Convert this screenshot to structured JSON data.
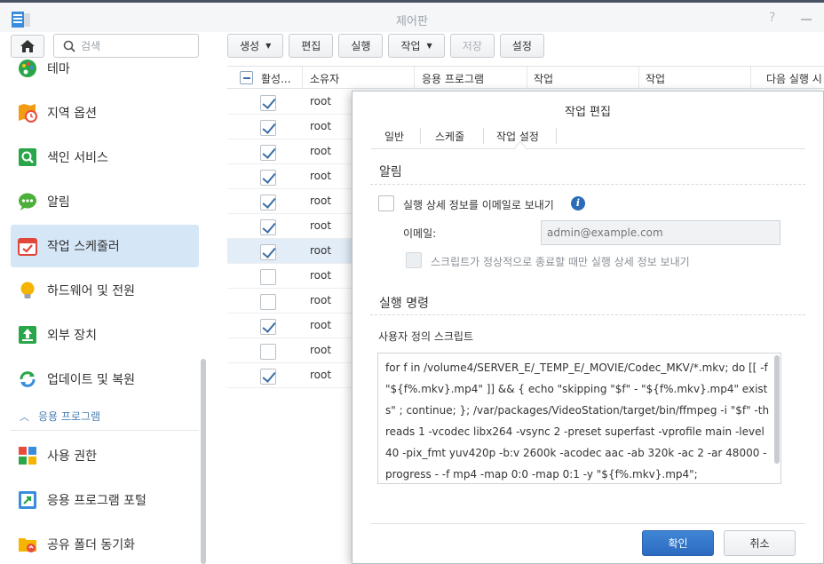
{
  "window": {
    "title": "제어판",
    "help_label": "?"
  },
  "sidebar": {
    "search_placeholder": "검색",
    "items": [
      {
        "label": "테마",
        "icon": "palette-icon"
      },
      {
        "label": "지역 옵션",
        "icon": "map-clock-icon"
      },
      {
        "label": "색인 서비스",
        "icon": "index-search-icon"
      },
      {
        "label": "알림",
        "icon": "chat-bubble-icon"
      },
      {
        "label": "작업 스케줄러",
        "icon": "calendar-check-icon",
        "active": true
      },
      {
        "label": "하드웨어 및 전원",
        "icon": "lightbulb-icon"
      },
      {
        "label": "외부 장치",
        "icon": "external-device-icon"
      },
      {
        "label": "업데이트 및 복원",
        "icon": "update-arrows-icon"
      },
      {
        "label": "사용 권한",
        "icon": "permission-icon"
      },
      {
        "label": "응용 프로그램 포털",
        "icon": "portal-arrow-icon"
      },
      {
        "label": "공유 폴더 동기화",
        "icon": "folder-sync-icon"
      }
    ],
    "group_label": "응용 프로그램"
  },
  "toolbar": {
    "create": "생성",
    "edit": "편집",
    "run": "실행",
    "action": "작업",
    "save": "저장",
    "settings": "설정"
  },
  "table": {
    "columns": [
      "활성...",
      "소유자",
      "응용 프로그램",
      "작업",
      "작업",
      "다음 실행 시"
    ],
    "rows": [
      {
        "enabled": true,
        "owner": "root"
      },
      {
        "enabled": true,
        "owner": "root"
      },
      {
        "enabled": true,
        "owner": "root"
      },
      {
        "enabled": true,
        "owner": "root"
      },
      {
        "enabled": true,
        "owner": "root"
      },
      {
        "enabled": true,
        "owner": "root"
      },
      {
        "enabled": true,
        "owner": "root",
        "selected": true
      },
      {
        "enabled": false,
        "owner": "root"
      },
      {
        "enabled": false,
        "owner": "root"
      },
      {
        "enabled": true,
        "owner": "root"
      },
      {
        "enabled": false,
        "owner": "root"
      },
      {
        "enabled": true,
        "owner": "root"
      }
    ]
  },
  "dialog": {
    "title": "작업 편집",
    "tabs": [
      "일반",
      "스케줄",
      "작업 설정"
    ],
    "active_tab": "작업 설정",
    "notification": {
      "section_title": "알림",
      "send_email_label": "실행 상세 정보를 이메일로 보내기",
      "send_email_checked": false,
      "email_label": "이메일:",
      "email_placeholder": "admin@example.com",
      "abnormal_only_label": "스크립트가 정상적으로 종료할 때만 실행 상세 정보 보내기",
      "abnormal_only_checked": false
    },
    "run_command": {
      "section_title": "실행 명령",
      "script_label": "사용자 정의 스크립트",
      "script": "for f in /volume4/SERVER_E/_TEMP_E/_MOVIE/Codec_MKV/*.mkv; do [[ -f \"${f%.mkv}.mp4\" ]] && { echo \"skipping \"$f\" - \"${f%.mkv}.mp4\" exists\" ; continue; }; /var/packages/VideoStation/target/bin/ffmpeg -i \"$f\" -threads 1 -vcodec libx264 -vsync 2 -preset superfast -vprofile main -level 40 -pix_fmt yuv420p -b:v 2600k -acodec aac -ab 320k -ac 2 -ar 48000 -progress - -f mp4 -map 0:0 -map 0:1 -y \"${f%.mkv}.mp4\";"
    },
    "ok_label": "확인",
    "cancel_label": "취소"
  },
  "colors": {
    "accent": "#2c6bc0",
    "active_sidebar": "#d5e6f7",
    "check": "#3a6ea5"
  }
}
